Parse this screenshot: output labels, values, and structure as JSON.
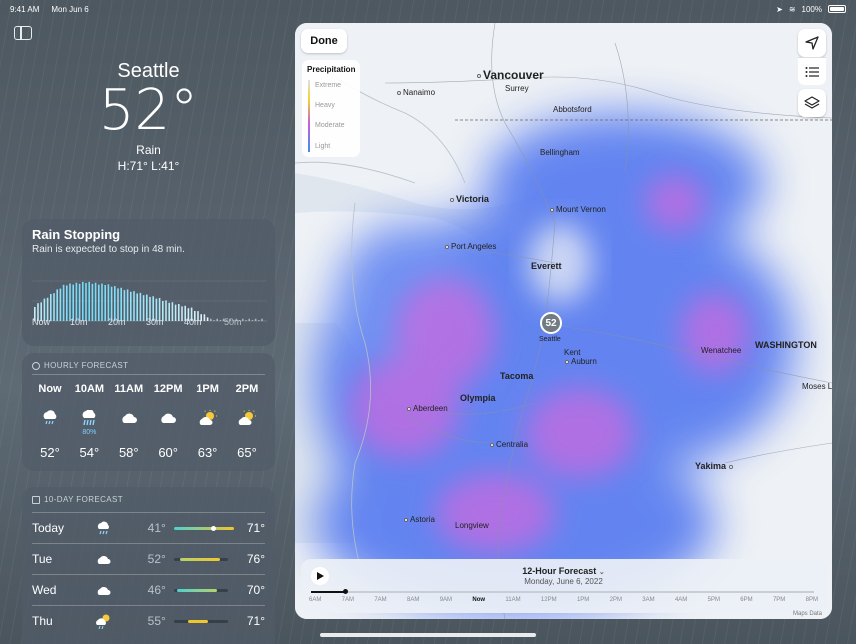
{
  "status": {
    "time": "9:41 AM",
    "date": "Mon Jun 6",
    "battery": "100%"
  },
  "hero": {
    "city": "Seattle",
    "temp": "52°",
    "condition": "Rain",
    "hilo": "H:71°  L:41°"
  },
  "rain_card": {
    "title": "Rain Stopping",
    "subtitle": "Rain is expected to stop in 48 min.",
    "labels": [
      "Now",
      "10m",
      "20m",
      "30m",
      "40m",
      "50m"
    ]
  },
  "hourly": {
    "header": "HOURLY FORECAST",
    "hours": [
      {
        "label": "Now",
        "icon": "rain-icon",
        "pop": "",
        "temp": "52°"
      },
      {
        "label": "10AM",
        "icon": "heavy-rain-icon",
        "pop": "80%",
        "temp": "54°"
      },
      {
        "label": "11AM",
        "icon": "cloud-icon",
        "pop": "",
        "temp": "58°"
      },
      {
        "label": "12PM",
        "icon": "cloud-icon",
        "pop": "",
        "temp": "60°"
      },
      {
        "label": "1PM",
        "icon": "partly-sunny-icon",
        "pop": "",
        "temp": "63°"
      },
      {
        "label": "2PM",
        "icon": "partly-sunny-icon",
        "pop": "",
        "temp": "65°"
      }
    ]
  },
  "daily": {
    "header": "10-DAY FORECAST",
    "days": [
      {
        "day": "Today",
        "icon": "rain-icon",
        "low": "41°",
        "high": "71°"
      },
      {
        "day": "Tue",
        "icon": "cloud-icon",
        "low": "52°",
        "high": "76°"
      },
      {
        "day": "Wed",
        "icon": "cloud-icon",
        "low": "46°",
        "high": "70°"
      },
      {
        "day": "Thu",
        "icon": "sun-rain-icon",
        "low": "55°",
        "high": "71°"
      }
    ]
  },
  "map": {
    "done": "Done",
    "legend": {
      "title": "Precipitation",
      "items": [
        "Extreme",
        "Heavy",
        "Moderate",
        "Light"
      ]
    },
    "pin": "52",
    "cities": {
      "vancouver": "Vancouver",
      "surrey": "Surrey",
      "nanaimo": "Nanaimo",
      "abbotsford": "Abbotsford",
      "bellingham": "Bellingham",
      "victoria": "Victoria",
      "mount_vernon": "Mount Vernon",
      "port_angeles": "Port Angeles",
      "everett": "Everett",
      "seattle": "Seattle",
      "kent": "Kent",
      "auburn": "Auburn",
      "tacoma": "Tacoma",
      "olympia": "Olympia",
      "aberdeen": "Aberdeen",
      "centralia": "Centralia",
      "wenatchee": "Wenatchee",
      "washington": "WASHINGTON",
      "moses_lake": "Moses L",
      "yakima": "Yakima",
      "astoria": "Astoria",
      "longview": "Longview"
    },
    "timeline": {
      "title": "12-Hour Forecast",
      "date": "Monday, June 6, 2022",
      "ticks": [
        "6AM",
        "7AM",
        "7AM",
        "8AM",
        "9AM",
        "Now",
        "11AM",
        "12PM",
        "1PM",
        "2PM",
        "3AM",
        "4AM",
        "5PM",
        "6PM",
        "7PM",
        "8PM"
      ]
    },
    "attribution": "Maps Data"
  }
}
